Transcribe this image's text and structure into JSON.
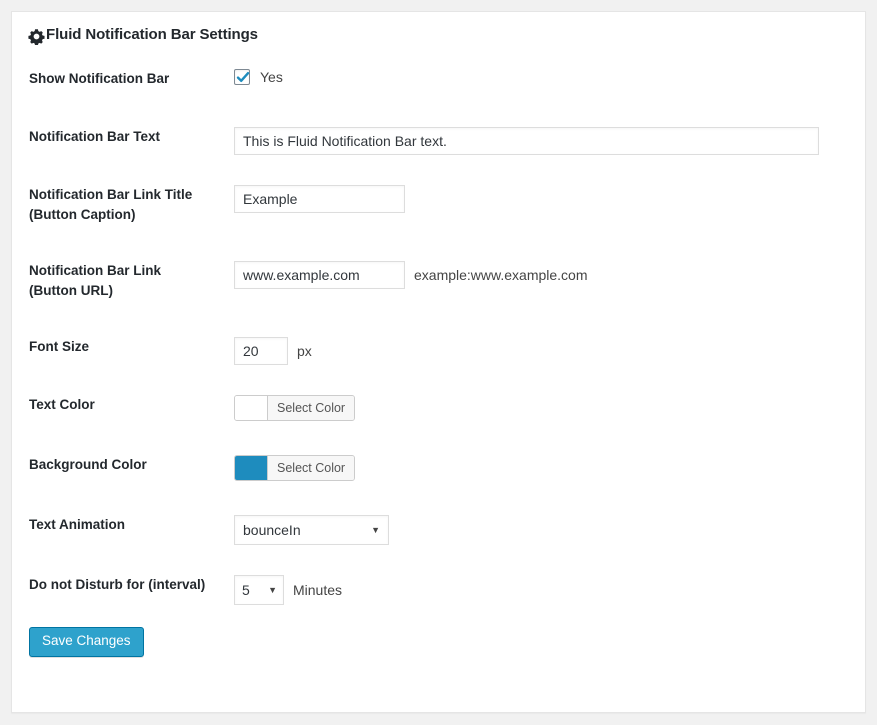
{
  "page": {
    "title": "Fluid Notification Bar Settings",
    "gear_icon": "gear-icon"
  },
  "colors": {
    "accent_blue": "#2ea2cc",
    "background_color_swatch": "#1e8cbe",
    "text_color_swatch": "#ffffff",
    "card_background": "#ffffff",
    "page_background": "#f1f1f1"
  },
  "form": {
    "show_notification_bar": {
      "label": "Show Notification Bar",
      "checkbox_checked": true,
      "checkbox_label": "Yes"
    },
    "notification_bar_text": {
      "label": "Notification Bar Text",
      "value": "This is Fluid Notification Bar text."
    },
    "notification_bar_link_title": {
      "label": "Notification Bar Link Title (Button Caption)",
      "label_line1": "Notification Bar Link Title",
      "label_line2": "(Button Caption)",
      "value": "Example"
    },
    "notification_bar_link": {
      "label": "Notification Bar Link (Button URL)",
      "label_line1": "Notification Bar Link",
      "label_line2": "(Button URL)",
      "value": "www.example.com",
      "hint": "example:www.example.com"
    },
    "font_size": {
      "label": "Font Size",
      "value": "20",
      "unit": "px"
    },
    "text_color": {
      "label": "Text Color",
      "button_label": "Select Color",
      "swatch": "#ffffff"
    },
    "background_color": {
      "label": "Background Color",
      "button_label": "Select Color",
      "swatch": "#1e8cbe"
    },
    "text_animation": {
      "label": "Text Animation",
      "selected": "bounceIn",
      "caret_icon": "chevron-down-icon"
    },
    "do_not_disturb": {
      "label": "Do not Disturb for (interval)",
      "selected": "5",
      "unit": "Minutes",
      "caret_icon": "chevron-down-icon"
    },
    "submit": {
      "label": "Save Changes"
    }
  }
}
